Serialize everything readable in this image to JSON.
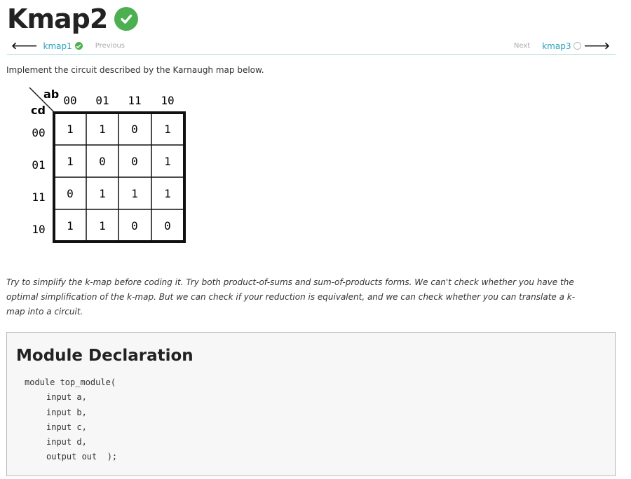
{
  "page": {
    "title": "Kmap2",
    "intro": "Implement the circuit described by the Karnaugh map below.",
    "hint": "Try to simplify the k-map before coding it. Try both product-of-sums and sum-of-products forms. We can't check whether you have the optimal simplification of the k-map. But we can check if your reduction is equivalent, and we can check whether you can translate a k-map into a circuit."
  },
  "nav": {
    "prev_link": "kmap1",
    "prev_label": "Previous",
    "next_label": "Next",
    "next_link": "kmap3"
  },
  "kmap": {
    "col_var": "ab",
    "row_var": "cd",
    "col_headers": [
      "00",
      "01",
      "11",
      "10"
    ],
    "row_headers": [
      "00",
      "01",
      "11",
      "10"
    ],
    "cells": [
      [
        "1",
        "1",
        "0",
        "1"
      ],
      [
        "1",
        "0",
        "0",
        "1"
      ],
      [
        "0",
        "1",
        "1",
        "1"
      ],
      [
        "1",
        "1",
        "0",
        "0"
      ]
    ]
  },
  "module": {
    "heading": "Module Declaration",
    "code_lines": [
      "module top_module(",
      "input a,",
      "input b,",
      "input c,",
      "input d,",
      "output out  );"
    ]
  },
  "colors": {
    "accent": "#2aa1b8",
    "success": "#4caf50"
  }
}
